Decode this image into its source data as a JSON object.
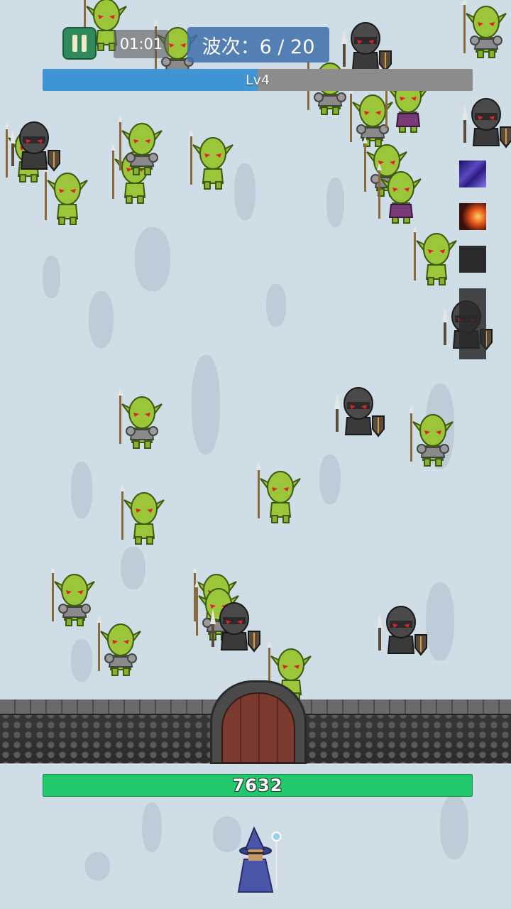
{
  "hud": {
    "timer": "01:01",
    "wave_text": "波次：6 / 20",
    "level_text": "Lv4",
    "level_progress": 0.5,
    "wall_hp": "7632"
  },
  "skills": [
    {
      "name": "arcane-storm-icon",
      "color": "#3a2a8a"
    },
    {
      "name": "fire-strike-icon",
      "color": "#5a1a10"
    },
    {
      "name": "empty-slot",
      "color": "#222222"
    },
    {
      "name": "empty-slot",
      "color": "#222222"
    }
  ],
  "colors": {
    "goblin": "#9bc63a",
    "knight": "#4a4a4a",
    "wizard": "#4b56a8",
    "hp": "#1fc96c",
    "xp": "#3f95d4"
  }
}
